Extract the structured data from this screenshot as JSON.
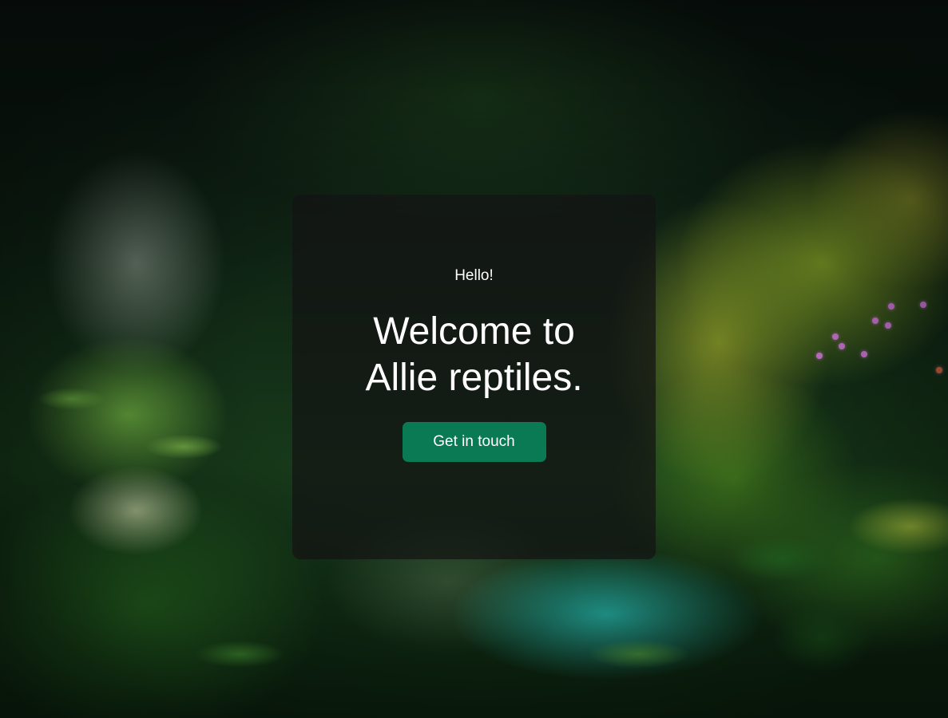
{
  "hero": {
    "greeting": "Hello!",
    "headline": "Welcome to Allie reptiles.",
    "cta_label": "Get in touch"
  },
  "colors": {
    "card_background": "#141414",
    "cta_background": "#0a7a55",
    "text": "#ffffff"
  },
  "background": {
    "image": "jungle-terrarium-photo"
  }
}
